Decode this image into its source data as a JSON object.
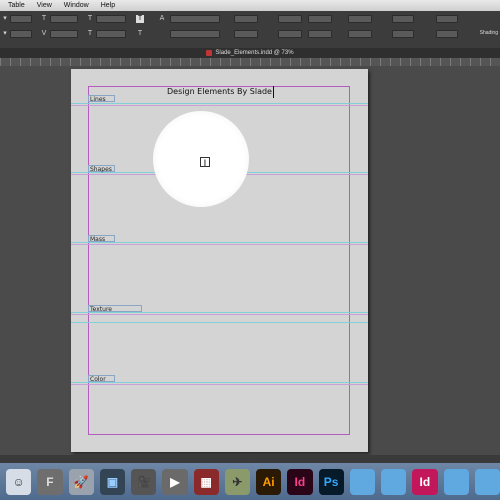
{
  "menu": [
    "Table",
    "View",
    "Window",
    "Help"
  ],
  "control_panel": {
    "fields_row1": [
      "",
      "",
      "",
      "",
      "",
      "",
      "",
      "",
      ""
    ],
    "fields_row2": [
      "",
      "",
      "",
      "",
      "",
      "",
      "",
      "",
      ""
    ],
    "right_label": "Shading"
  },
  "document_tab": "Slade_Elements.indd @ 73%",
  "page": {
    "title": "Design Elements By Slade",
    "sections": [
      "Lines",
      "Shapes",
      "Mass",
      "Texture",
      "Color"
    ]
  },
  "cursor": {
    "icon": "text-cursor-icon",
    "glyph": "Ⅰ"
  },
  "dock": [
    {
      "name": "finder-icon",
      "label": "☺",
      "bg": "#d6dde6",
      "fg": "#333"
    },
    {
      "name": "fontbook-icon",
      "label": "F",
      "bg": "#6e6e6e",
      "fg": "#ddd"
    },
    {
      "name": "launchpad-icon",
      "label": "🚀",
      "bg": "#9aa3ad",
      "fg": "#222"
    },
    {
      "name": "photo-app-icon",
      "label": "▣",
      "bg": "#345",
      "fg": "#9cf"
    },
    {
      "name": "video-app-icon",
      "label": "🎥",
      "bg": "#555",
      "fg": "#ddd"
    },
    {
      "name": "preview-icon",
      "label": "▶",
      "bg": "#6a6a6a",
      "fg": "#fff"
    },
    {
      "name": "photobooth-icon",
      "label": "▦",
      "bg": "#8a2a2a",
      "fg": "#fff"
    },
    {
      "name": "airplane-icon",
      "label": "✈",
      "bg": "#8a9a6a",
      "fg": "#333"
    },
    {
      "name": "illustrator-icon",
      "label": "Ai",
      "bg": "#2a1a05",
      "fg": "#ff9a00"
    },
    {
      "name": "indesign-icon",
      "label": "Id",
      "bg": "#2a0518",
      "fg": "#ff3d8f"
    },
    {
      "name": "photoshop-icon",
      "label": "Ps",
      "bg": "#061a2a",
      "fg": "#31a8ff"
    },
    {
      "name": "folder-icon",
      "label": "",
      "bg": "#5fa8e0",
      "fg": "#fff"
    },
    {
      "name": "folder-icon",
      "label": "",
      "bg": "#5fa8e0",
      "fg": "#fff"
    },
    {
      "name": "indesign-doc-icon",
      "label": "Id",
      "bg": "#c2185b",
      "fg": "#fff"
    },
    {
      "name": "folder-icon",
      "label": "",
      "bg": "#5fa8e0",
      "fg": "#fff"
    },
    {
      "name": "folder-icon",
      "label": "",
      "bg": "#5fa8e0",
      "fg": "#fff"
    }
  ],
  "colors": {
    "margin": "#b45dbf",
    "guide": "#7ad0d8",
    "page": "#d4d4d4"
  }
}
